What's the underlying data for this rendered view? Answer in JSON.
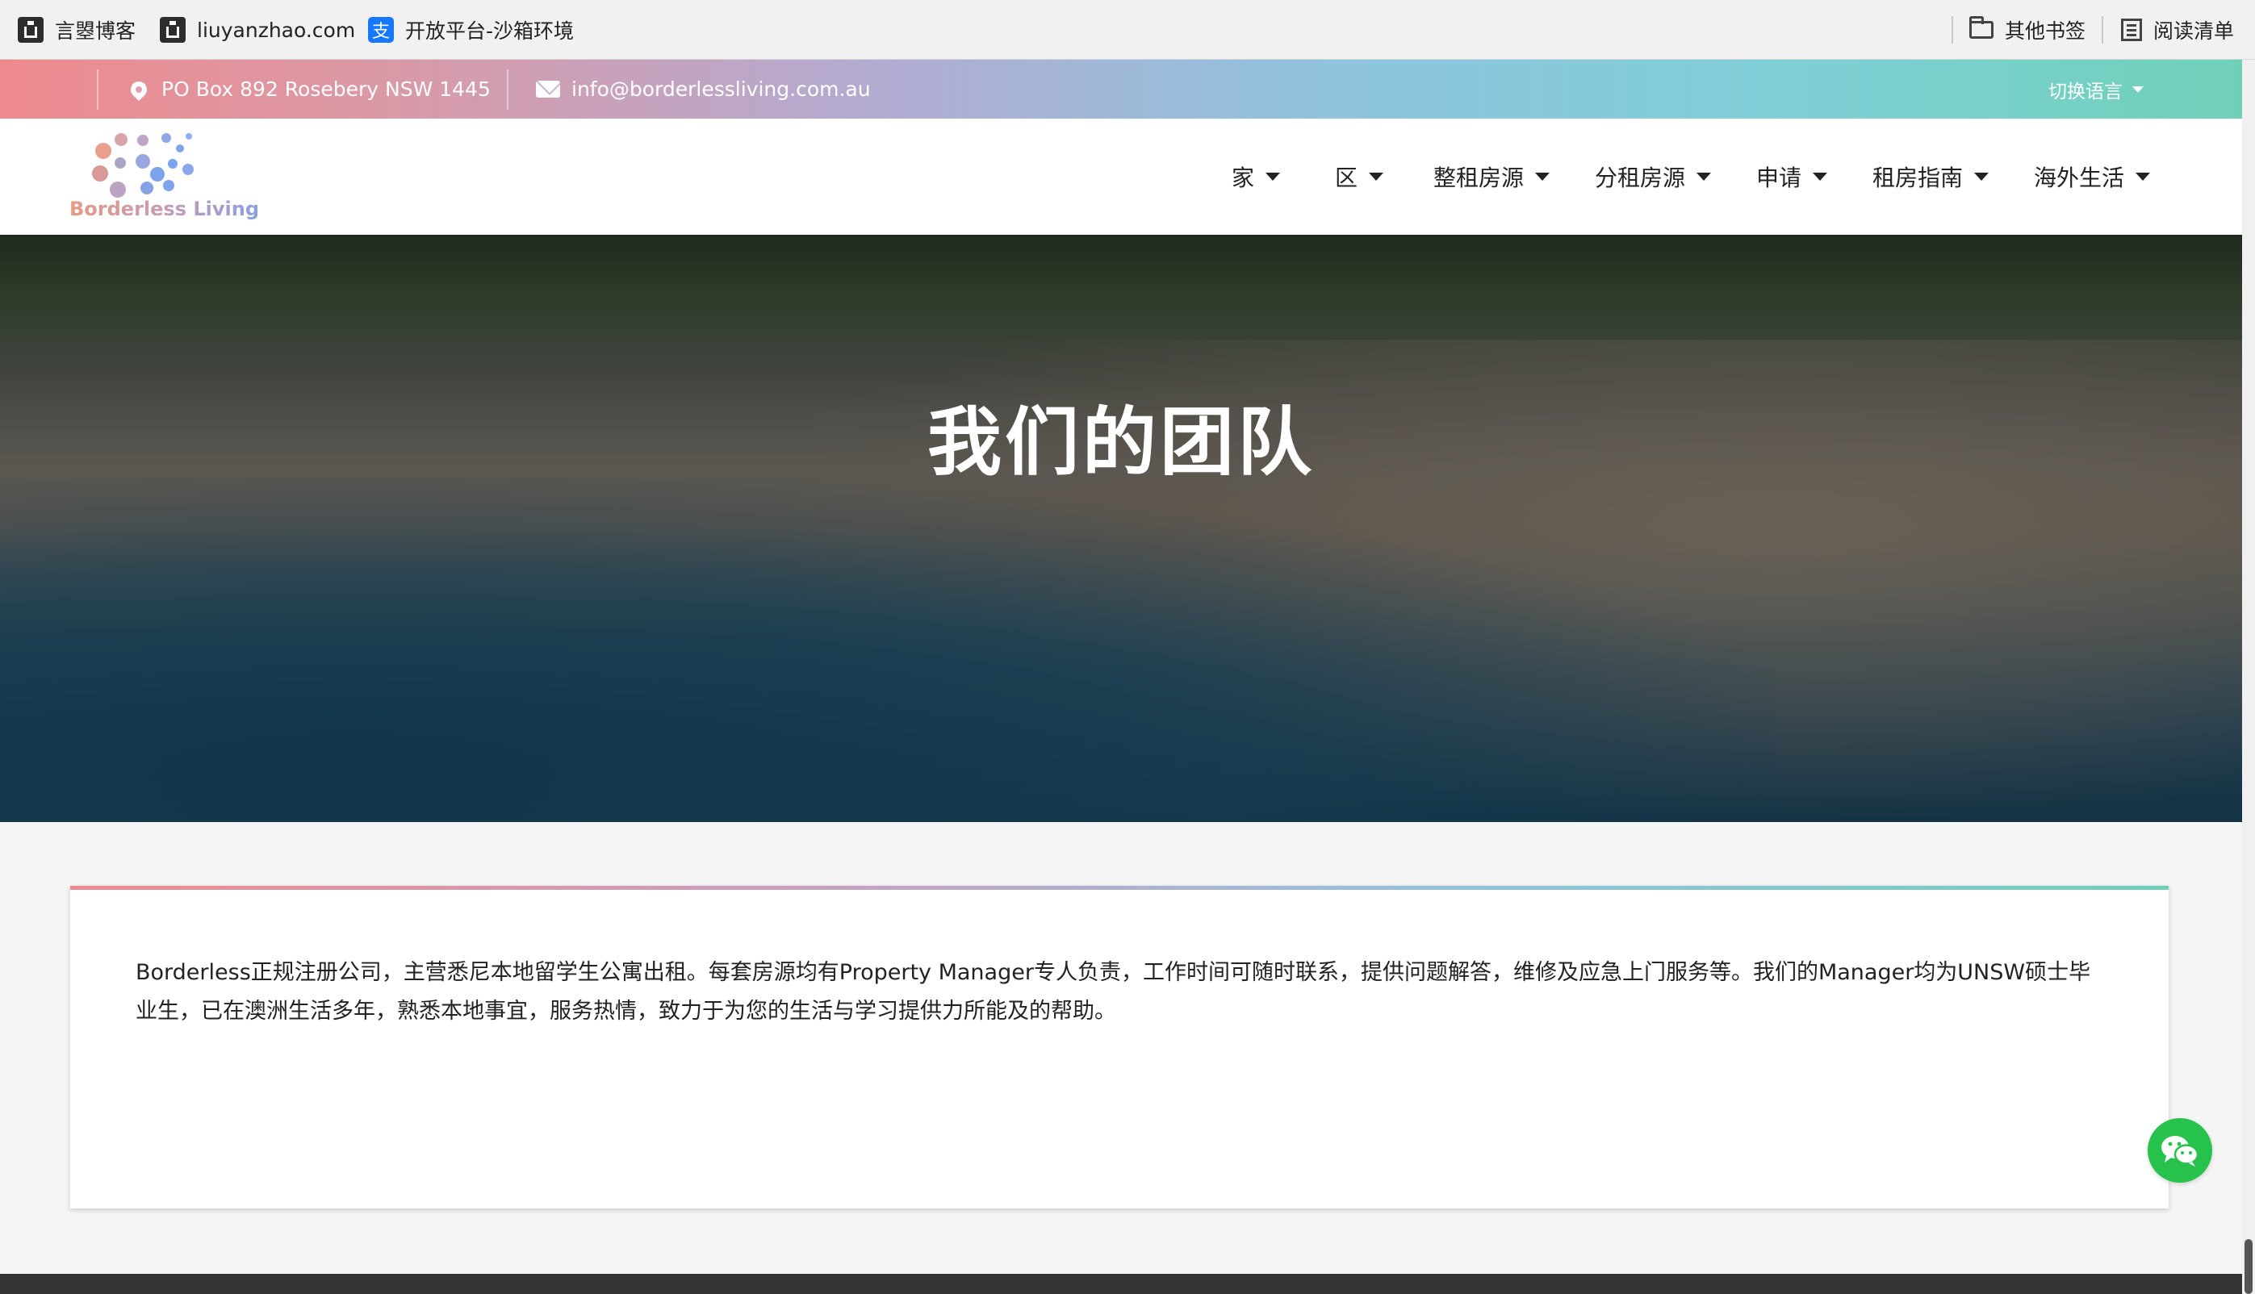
{
  "bookmarks": {
    "items": [
      "言曌博客",
      "liuyanzhao.com",
      "开放平台-沙箱环境"
    ],
    "other_bookmarks": "其他书签",
    "reading_list": "阅读清单"
  },
  "infobar": {
    "address": "PO Box 892 Rosebery NSW 1445",
    "email": "info@borderlessliving.com.au",
    "language_switch": "切换语言"
  },
  "brand": {
    "logo_text": "Borderless Living"
  },
  "nav": {
    "items": [
      "家",
      "区",
      "整租房源",
      "分租房源",
      "申请",
      "租房指南",
      "海外生活"
    ]
  },
  "hero": {
    "title": "我们的团队"
  },
  "content": {
    "paragraph": "Borderless正规注册公司，主营悉尼本地留学生公寓出租。每套房源均有Property Manager专人负责，工作时间可随时联系，提供问题解答，维修及应急上门服务等。我们的Manager均为UNSW硕士毕业生，已在澳洲生活多年，熟悉本地事宜，服务热情，致力于为您的生活与学习提供力所能及的帮助。"
  },
  "colors": {
    "gradient_start": "#ee8a8e",
    "gradient_mid": "#8ec4de",
    "gradient_end": "#6fd0b8",
    "wechat_green": "#27c24c"
  }
}
